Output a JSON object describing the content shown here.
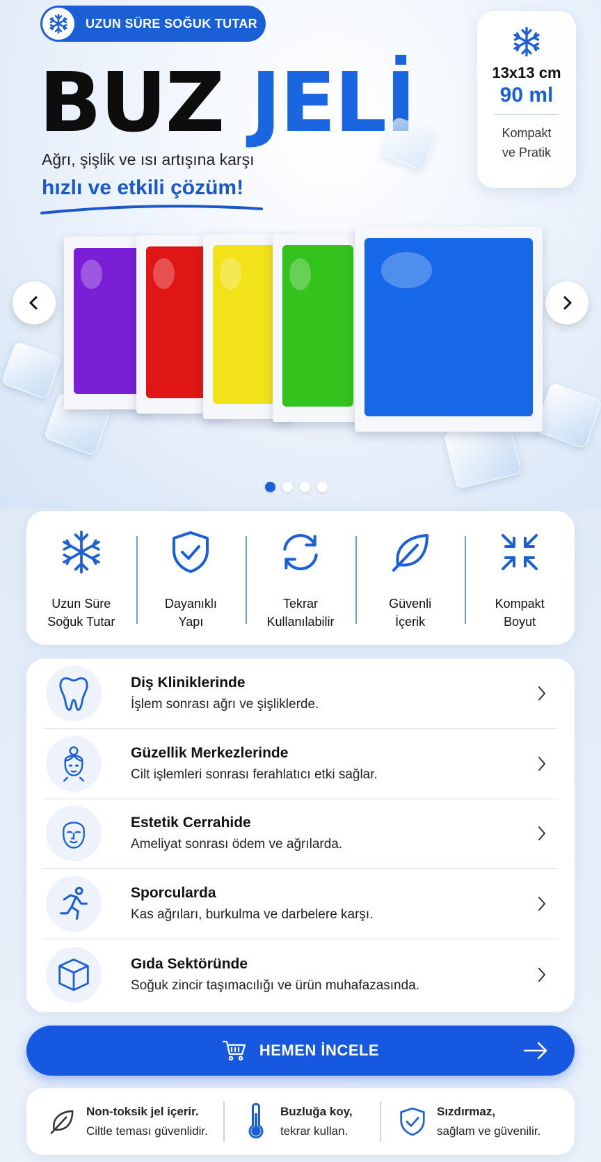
{
  "hero": {
    "badge_text": "UZUN SÜRE SOĞUK TUTAR",
    "title_black": "BUZ",
    "title_blue": "JELİ",
    "subtitle": "Ağrı, şişlik ve ısı artışına karşı",
    "subtitle_strong": "hızlı ve etkili çözüm!",
    "spec": {
      "size": "13x13 cm",
      "volume": "90 ml",
      "desc_line1": "Kompakt",
      "desc_line2": "ve Pratik"
    },
    "carousel": {
      "dots": 4,
      "active_dot": 1,
      "gel_colors": [
        "#7a1fd6",
        "#e01515",
        "#f2e21a",
        "#34c21c",
        "#1668e8"
      ]
    }
  },
  "features": [
    {
      "label": "Uzun Süre\nSoğuk Tutar",
      "icon": "snowflake-icon"
    },
    {
      "label": "Dayanıklı\nYapı",
      "icon": "shield-check-icon"
    },
    {
      "label": "Tekrar\nKullanılabilir",
      "icon": "refresh-icon"
    },
    {
      "label": "Güvenli\nİçerik",
      "icon": "leaf-icon"
    },
    {
      "label": "Kompakt\nBoyut",
      "icon": "compress-icon"
    }
  ],
  "uses": [
    {
      "title": "Diş Kliniklerinde",
      "desc": "İşlem sonrası ağrı ve şişliklerde.",
      "icon": "tooth-icon"
    },
    {
      "title": "Güzellik Merkezlerinde",
      "desc": "Cilt işlemleri sonrası ferahlatıcı etki sağlar.",
      "icon": "woman-face-icon"
    },
    {
      "title": "Estetik Cerrahide",
      "desc": "Ameliyat sonrası ödem ve ağrılarda.",
      "icon": "face-icon"
    },
    {
      "title": "Sporcularda",
      "desc": "Kas ağrıları, burkulma ve darbelere karşı.",
      "icon": "runner-icon"
    },
    {
      "title": "Gıda Sektöründe",
      "desc": "Soğuk zincir taşımacılığı ve ürün muhafazasında.",
      "icon": "box-icon"
    }
  ],
  "cta": {
    "label": "HEMEN İNCELE"
  },
  "info": [
    {
      "title": "Non-toksik jel içerir.",
      "desc": "Ciltle teması güvenlidir.",
      "icon": "leaf-icon"
    },
    {
      "title": "Buzluğa koy,",
      "desc": "tekrar kullan.",
      "icon": "thermometer-icon"
    },
    {
      "title": "Sızdırmaz,",
      "desc": "sağlam ve güvenilir.",
      "icon": "shield-check-icon"
    }
  ],
  "colors": {
    "brand_blue": "#1a5fd6",
    "cta_blue": "#1659e0"
  }
}
